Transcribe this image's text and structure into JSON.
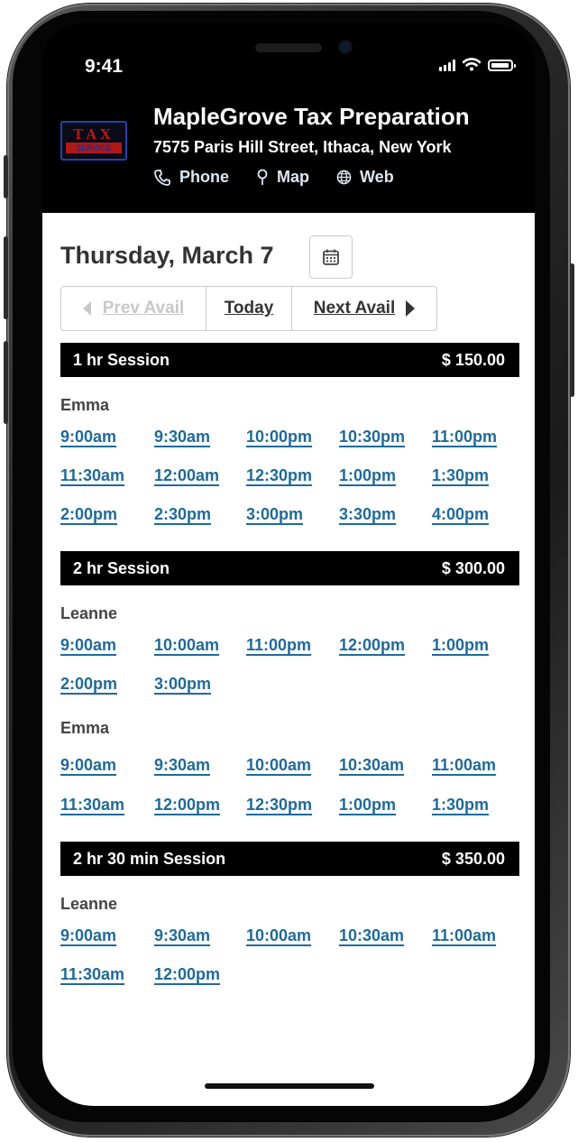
{
  "status": {
    "time": "9:41"
  },
  "header": {
    "logo_top": "TAX",
    "logo_bottom": "SERVICE",
    "name": "MapleGrove Tax Preparation",
    "address": "7575 Paris Hill Street, Ithaca, New York",
    "links": [
      {
        "label": "Phone",
        "icon": "phone-icon"
      },
      {
        "label": "Map",
        "icon": "map-pin-icon"
      },
      {
        "label": "Web",
        "icon": "globe-icon"
      }
    ]
  },
  "date": {
    "title": "Thursday, March 7"
  },
  "nav": {
    "prev": "Prev Avail",
    "today": "Today",
    "next": "Next Avail"
  },
  "sessions": [
    {
      "name": "1 hr Session",
      "price": "$ 150.00",
      "staff": [
        {
          "name": "Emma",
          "slots": [
            "9:00am",
            "9:30am",
            "10:00pm",
            "10:30pm",
            "11:00pm",
            "11:30am",
            "12:00am",
            "12:30pm",
            "1:00pm",
            "1:30pm",
            "2:00pm",
            "2:30pm",
            "3:00pm",
            "3:30pm",
            "4:00pm"
          ]
        }
      ]
    },
    {
      "name": "2 hr Session",
      "price": "$ 300.00",
      "staff": [
        {
          "name": "Leanne",
          "slots": [
            "9:00am",
            "10:00am",
            "11:00pm",
            "12:00pm",
            "1:00pm",
            "2:00pm",
            "3:00pm"
          ]
        },
        {
          "name": "Emma",
          "slots": [
            "9:00am",
            "9:30am",
            "10:00am",
            "10:30am",
            "11:00am",
            "11:30am",
            "12:00pm",
            "12:30pm",
            "1:00pm",
            "1:30pm"
          ]
        }
      ]
    },
    {
      "name": "2 hr 30 min Session",
      "price": "$ 350.00",
      "staff": [
        {
          "name": "Leanne",
          "slots": [
            "9:00am",
            "9:30am",
            "10:00am",
            "10:30am",
            "11:00am",
            "11:30am",
            "12:00pm"
          ]
        }
      ]
    }
  ],
  "colors": {
    "link": "#1f6a99",
    "bar": "#000000",
    "text": "#333333"
  }
}
